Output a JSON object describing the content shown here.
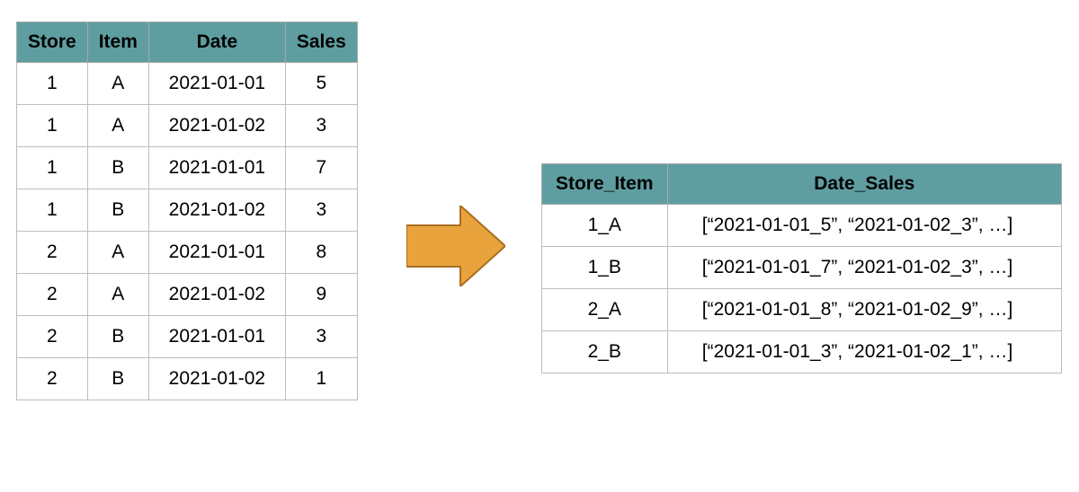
{
  "colors": {
    "header_bg": "#5f9ea0",
    "arrow_fill": "#e8a33d",
    "arrow_stroke": "#a86f20",
    "border": "#bdbdbd"
  },
  "left_table": {
    "headers": [
      "Store",
      "Item",
      "Date",
      "Sales"
    ],
    "rows": [
      [
        "1",
        "A",
        "2021-01-01",
        "5"
      ],
      [
        "1",
        "A",
        "2021-01-02",
        "3"
      ],
      [
        "1",
        "B",
        "2021-01-01",
        "7"
      ],
      [
        "1",
        "B",
        "2021-01-02",
        "3"
      ],
      [
        "2",
        "A",
        "2021-01-01",
        "8"
      ],
      [
        "2",
        "A",
        "2021-01-02",
        "9"
      ],
      [
        "2",
        "B",
        "2021-01-01",
        "3"
      ],
      [
        "2",
        "B",
        "2021-01-02",
        "1"
      ]
    ]
  },
  "right_table": {
    "headers": [
      "Store_Item",
      "Date_Sales"
    ],
    "rows": [
      [
        "1_A",
        "[“2021-01-01_5”, “2021-01-02_3”, …]"
      ],
      [
        "1_B",
        "[“2021-01-01_7”, “2021-01-02_3”, …]"
      ],
      [
        "2_A",
        "[“2021-01-01_8”, “2021-01-02_9”, …]"
      ],
      [
        "2_B",
        "[“2021-01-01_3”, “2021-01-02_1”, …]"
      ]
    ]
  }
}
